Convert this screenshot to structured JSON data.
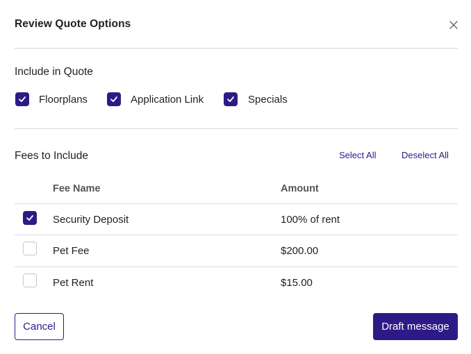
{
  "dialog": {
    "title": "Review Quote Options",
    "close_icon": "close-icon"
  },
  "include_section": {
    "title": "Include in Quote",
    "options": [
      {
        "label": "Floorplans",
        "checked": true
      },
      {
        "label": "Application Link",
        "checked": true
      },
      {
        "label": "Specials",
        "checked": true
      }
    ]
  },
  "fees_section": {
    "title": "Fees to Include",
    "select_all": "Select All",
    "deselect_all": "Deselect All",
    "columns": {
      "name": "Fee Name",
      "amount": "Amount"
    },
    "rows": [
      {
        "name": "Security Deposit",
        "amount": "100% of rent",
        "checked": true
      },
      {
        "name": "Pet Fee",
        "amount": "$200.00",
        "checked": false
      },
      {
        "name": "Pet Rent",
        "amount": "$15.00",
        "checked": false
      }
    ]
  },
  "footer": {
    "cancel_label": "Cancel",
    "primary_label": "Draft message"
  },
  "colors": {
    "accent": "#2e1a87",
    "divider": "#d5d5d9",
    "text": "#1f1f24"
  }
}
